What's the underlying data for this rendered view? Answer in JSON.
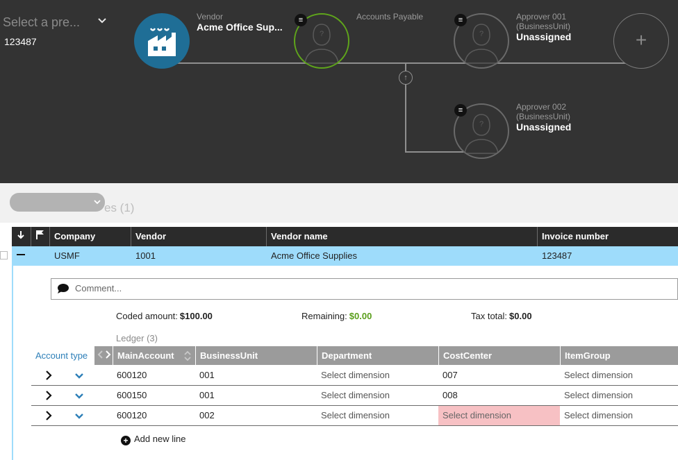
{
  "workflow": {
    "preset_placeholder": "Select a pre...",
    "preset_value": "123487",
    "vendor": {
      "label": "Vendor",
      "name": "Acme Office Sup..."
    },
    "accounts_payable": {
      "label": "Accounts Payable"
    },
    "approver1": {
      "label_line1": "Approver 001",
      "label_line2": "(BusinessUnit)",
      "value": "Unassigned"
    },
    "approver2": {
      "label_line1": "Approver 002",
      "label_line2": "(BusinessUnit)",
      "value": "Unassigned"
    },
    "add_symbol": "+",
    "menu_symbol": "≡",
    "escalate_symbol": "↑"
  },
  "band": {
    "title": "es (1)"
  },
  "invoice_grid": {
    "headers": {
      "company": "Company",
      "vendor": "Vendor",
      "vendor_name": "Vendor name",
      "invoice_number": "Invoice number"
    },
    "row": {
      "company": "USMF",
      "vendor": "1001",
      "vendor_name": "Acme Office Supplies",
      "invoice_number": "123487"
    }
  },
  "comment": {
    "placeholder": "Comment..."
  },
  "summary": {
    "coded_amount_label": "Coded amount:",
    "coded_amount": "$100.00",
    "remaining_label": "Remaining:",
    "remaining": "$0.00",
    "tax_total_label": "Tax total:",
    "tax_total": "$0.00"
  },
  "ledger": {
    "title": "Ledger (3)",
    "account_type_label": "Account type",
    "headers": {
      "main_account": "MainAccount",
      "business_unit": "BusinessUnit",
      "department": "Department",
      "cost_center": "CostCenter",
      "item_group": "ItemGroup"
    },
    "rows": [
      {
        "main_account": "600120",
        "business_unit": "001",
        "department": "Select dimension",
        "cost_center": "007",
        "item_group": "Select dimension"
      },
      {
        "main_account": "600150",
        "business_unit": "001",
        "department": "Select dimension",
        "cost_center": "008",
        "item_group": "Select dimension"
      },
      {
        "main_account": "600120",
        "business_unit": "002",
        "department": "Select dimension",
        "cost_center": "Select dimension",
        "item_group": "Select dimension"
      }
    ],
    "add_line_label": "Add new line"
  },
  "colors": {
    "header_bg": "#333333",
    "vendor_circle": "#1f6e96",
    "active_ring": "#5fa51b",
    "selected_row": "#9edcfb",
    "error_cell": "#f7c1c4",
    "remaining_green": "#5a9e1b",
    "link_blue": "#2d7fb8"
  }
}
